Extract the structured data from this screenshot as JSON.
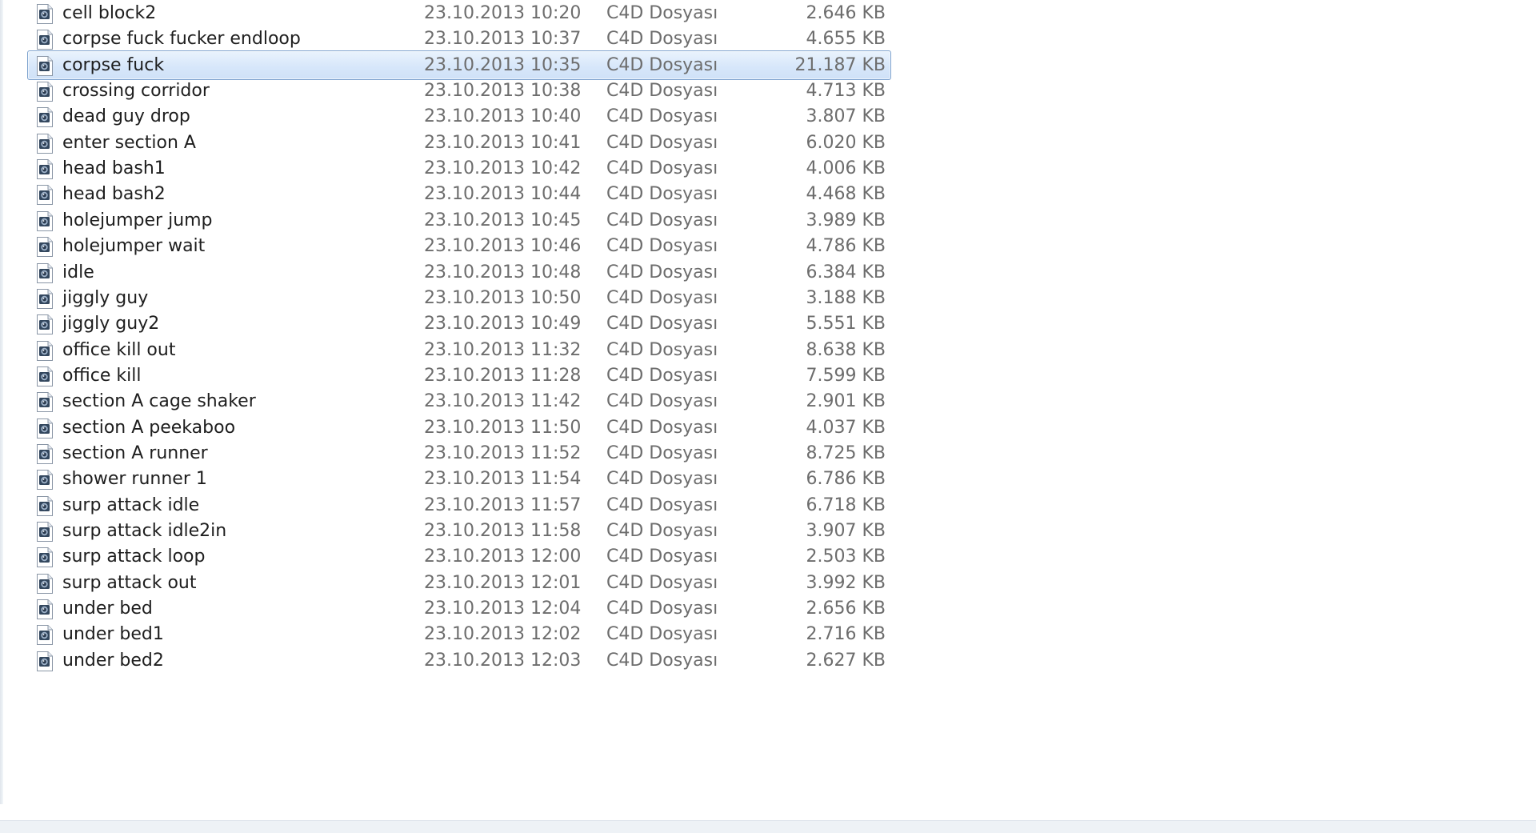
{
  "file_list": {
    "files": [
      {
        "name": "cell block2",
        "date": "23.10.2013 10:20",
        "type": "C4D Dosyası",
        "size": "2.646 KB",
        "icon": "c4d-file-icon",
        "selected": false
      },
      {
        "name": "corpse fuck fucker endloop",
        "date": "23.10.2013 10:37",
        "type": "C4D Dosyası",
        "size": "4.655 KB",
        "icon": "c4d-file-icon",
        "selected": false
      },
      {
        "name": "corpse fuck",
        "date": "23.10.2013 10:35",
        "type": "C4D Dosyası",
        "size": "21.187 KB",
        "icon": "c4d-file-icon",
        "selected": true
      },
      {
        "name": "crossing corridor",
        "date": "23.10.2013 10:38",
        "type": "C4D Dosyası",
        "size": "4.713 KB",
        "icon": "c4d-file-icon",
        "selected": false
      },
      {
        "name": "dead guy drop",
        "date": "23.10.2013 10:40",
        "type": "C4D Dosyası",
        "size": "3.807 KB",
        "icon": "c4d-file-icon",
        "selected": false
      },
      {
        "name": "enter section A",
        "date": "23.10.2013 10:41",
        "type": "C4D Dosyası",
        "size": "6.020 KB",
        "icon": "c4d-file-icon",
        "selected": false
      },
      {
        "name": "head bash1",
        "date": "23.10.2013 10:42",
        "type": "C4D Dosyası",
        "size": "4.006 KB",
        "icon": "c4d-file-icon",
        "selected": false
      },
      {
        "name": "head bash2",
        "date": "23.10.2013 10:44",
        "type": "C4D Dosyası",
        "size": "4.468 KB",
        "icon": "c4d-file-icon",
        "selected": false
      },
      {
        "name": "holejumper jump",
        "date": "23.10.2013 10:45",
        "type": "C4D Dosyası",
        "size": "3.989 KB",
        "icon": "c4d-file-icon",
        "selected": false
      },
      {
        "name": "holejumper wait",
        "date": "23.10.2013 10:46",
        "type": "C4D Dosyası",
        "size": "4.786 KB",
        "icon": "c4d-file-icon",
        "selected": false
      },
      {
        "name": "idle",
        "date": "23.10.2013 10:48",
        "type": "C4D Dosyası",
        "size": "6.384 KB",
        "icon": "c4d-file-icon",
        "selected": false
      },
      {
        "name": "jiggly guy",
        "date": "23.10.2013 10:50",
        "type": "C4D Dosyası",
        "size": "3.188 KB",
        "icon": "c4d-file-icon",
        "selected": false
      },
      {
        "name": "jiggly guy2",
        "date": "23.10.2013 10:49",
        "type": "C4D Dosyası",
        "size": "5.551 KB",
        "icon": "c4d-file-icon",
        "selected": false
      },
      {
        "name": "office kill out",
        "date": "23.10.2013 11:32",
        "type": "C4D Dosyası",
        "size": "8.638 KB",
        "icon": "c4d-file-icon",
        "selected": false
      },
      {
        "name": "office kill",
        "date": "23.10.2013 11:28",
        "type": "C4D Dosyası",
        "size": "7.599 KB",
        "icon": "c4d-file-icon",
        "selected": false
      },
      {
        "name": "section A cage shaker",
        "date": "23.10.2013 11:42",
        "type": "C4D Dosyası",
        "size": "2.901 KB",
        "icon": "c4d-file-icon",
        "selected": false
      },
      {
        "name": "section A peekaboo",
        "date": "23.10.2013 11:50",
        "type": "C4D Dosyası",
        "size": "4.037 KB",
        "icon": "c4d-file-icon",
        "selected": false
      },
      {
        "name": "section A runner",
        "date": "23.10.2013 11:52",
        "type": "C4D Dosyası",
        "size": "8.725 KB",
        "icon": "c4d-file-icon",
        "selected": false
      },
      {
        "name": "shower runner 1",
        "date": "23.10.2013 11:54",
        "type": "C4D Dosyası",
        "size": "6.786 KB",
        "icon": "c4d-file-icon",
        "selected": false
      },
      {
        "name": "surp attack idle",
        "date": "23.10.2013 11:57",
        "type": "C4D Dosyası",
        "size": "6.718 KB",
        "icon": "c4d-file-icon",
        "selected": false
      },
      {
        "name": "surp attack idle2in",
        "date": "23.10.2013 11:58",
        "type": "C4D Dosyası",
        "size": "3.907 KB",
        "icon": "c4d-file-icon",
        "selected": false
      },
      {
        "name": "surp attack loop",
        "date": "23.10.2013 12:00",
        "type": "C4D Dosyası",
        "size": "2.503 KB",
        "icon": "c4d-file-icon",
        "selected": false
      },
      {
        "name": "surp attack out",
        "date": "23.10.2013 12:01",
        "type": "C4D Dosyası",
        "size": "3.992 KB",
        "icon": "c4d-file-icon",
        "selected": false
      },
      {
        "name": "under bed",
        "date": "23.10.2013 12:04",
        "type": "C4D Dosyası",
        "size": "2.656 KB",
        "icon": "c4d-file-icon",
        "selected": false
      },
      {
        "name": "under bed1",
        "date": "23.10.2013 12:02",
        "type": "C4D Dosyası",
        "size": "2.716 KB",
        "icon": "c4d-file-icon",
        "selected": false
      },
      {
        "name": "under bed2",
        "date": "23.10.2013 12:03",
        "type": "C4D Dosyası",
        "size": "2.627 KB",
        "icon": "c4d-file-icon",
        "selected": false
      }
    ]
  },
  "colors": {
    "selection_fill": "#d7e7fa",
    "selection_border": "#7da2ce",
    "name_text": "#1e1e1e",
    "detail_text": "#6d6d6d"
  }
}
